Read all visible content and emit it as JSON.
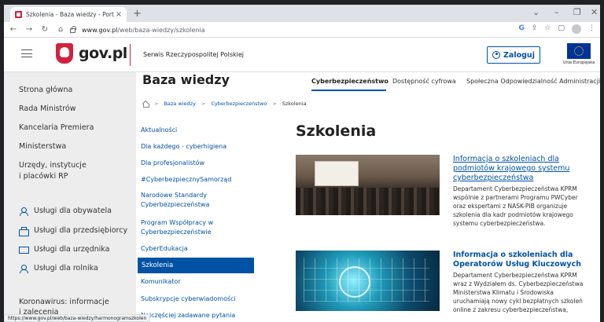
{
  "browser": {
    "tab_title": "Szkolenia - Baza wiedzy - Portal",
    "tab_close": "×",
    "newtab": "+",
    "url_host": "www.gov.pl",
    "url_path": "/web/baza-wiedzy/szkolenia",
    "status_url": "https://www.gov.pl/web/baza-wiedzy/harmonogramszkolen"
  },
  "header": {
    "logo_text": "gov.pl",
    "service_name": "Serwis Rzeczypospolitej Polskiej",
    "login_label": "Zaloguj",
    "eu_label": "Unia Europejska"
  },
  "sidebar": {
    "items": [
      {
        "label": "Strona główna"
      },
      {
        "label": "Rada Ministrów"
      },
      {
        "label": "Kancelaria Premiera"
      },
      {
        "label": "Ministerstwa"
      },
      {
        "label": "Urzędy, instytucje"
      },
      {
        "label": "i placówki RP"
      }
    ],
    "services": [
      {
        "label": "Usługi dla obywatela",
        "icon": "person-icon"
      },
      {
        "label": "Usługi dla przedsiębiorcy",
        "icon": "briefcase-icon"
      },
      {
        "label": "Usługi dla urzędnika",
        "icon": "monitor-icon"
      },
      {
        "label": "Usługi dla rolnika",
        "icon": "person-icon"
      }
    ],
    "bottom": [
      {
        "label": "Koronawirus: informacje"
      },
      {
        "label": "i zalecenia"
      }
    ]
  },
  "page": {
    "title": "Baza wiedzy",
    "topnav": [
      {
        "label": "Cyberbezpieczeństwo",
        "active": true
      },
      {
        "label": "Dostępność cyfrowa"
      },
      {
        "label": "Społeczna Odpowiedzialność Administracji"
      }
    ],
    "breadcrumb": [
      "Baza wiedzy",
      ">",
      "Cyberbezpieczeństwo",
      ">",
      "Szkolenia"
    ],
    "subnav": [
      "Aktualności",
      "Dla każdego - cyberhigiena",
      "Dla profesjonalistów",
      "#CyberbezpiecznySamorząd",
      "Narodowe Standardy",
      "Cyberbezpieczeństwa",
      "Program Współpracy w",
      "Cyberbezpieczeństwie",
      "CyberEdukacja",
      "Szkolenia",
      "Komunikator",
      "Subskrypcje cyberwiadomości",
      "Najczęściej zadawane pytania"
    ],
    "section_title": "Szkolenia",
    "articles": [
      {
        "title_lines": [
          "Informacja o szkoleniach dla",
          "podmiotów krajowego systemu",
          "cyberbezpieczeństwa"
        ],
        "desc_lines": [
          "Departament Cyberbezpieczeństwa KPRM",
          "wspólnie z partnerami Programu PWCyber",
          "oraz ekspertami z NASK-PIB organizuje",
          "szkolenia dla kadr podmiotów krajowego",
          "systemu cyberbezpieczeństwa."
        ]
      },
      {
        "title_lines": [
          "Informacja o szkoleniach dla",
          "Operatorów Usług Kluczowych"
        ],
        "desc_lines": [
          "Departament Cyberbezpieczeństwa KPRM",
          "wraz z Wydziałem ds. Cyberbezpieczeństwa",
          "Ministerstwa Klimatu i Środowiska",
          "uruchamiają nowy cykl bezpłatnych szkoleń",
          "online z zakresu cyberbezpieczeństwa,"
        ]
      }
    ]
  }
}
